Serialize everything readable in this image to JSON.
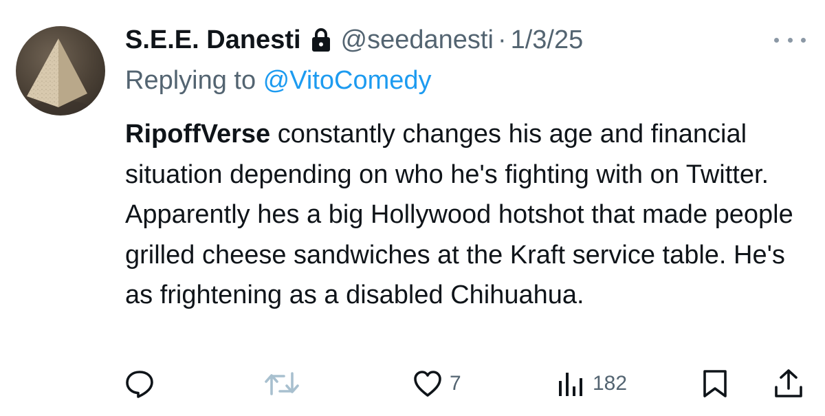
{
  "author": {
    "display_name": "S.E.E. Danesti",
    "handle": "@seedanesti",
    "separator": "·",
    "date": "1/3/25",
    "protected_icon": "lock-icon",
    "avatar": "pyramid-avatar"
  },
  "reply": {
    "prefix": "Replying to ",
    "mention": "@VitoComedy"
  },
  "body": {
    "bold_lead": "RipoffVerse",
    "text": " constantly changes his age and financial situation depending on who he's fighting with on Twitter. Apparently hes a big Hollywood hotshot that made people grilled cheese sandwiches at the Kraft service table. He's as frightening as a disabled Chihuahua."
  },
  "actions": {
    "reply": {
      "icon": "reply-icon",
      "count": ""
    },
    "retweet": {
      "icon": "retweet-icon",
      "count": ""
    },
    "like": {
      "icon": "heart-icon",
      "count": "7"
    },
    "views": {
      "icon": "views-icon",
      "count": "182"
    },
    "bookmark": {
      "icon": "bookmark-icon"
    },
    "share": {
      "icon": "share-icon"
    }
  },
  "colors": {
    "text": "#0f1419",
    "secondary": "#536471",
    "mention": "#1d9bf0",
    "retweet_disabled": "#a8c0cf"
  }
}
